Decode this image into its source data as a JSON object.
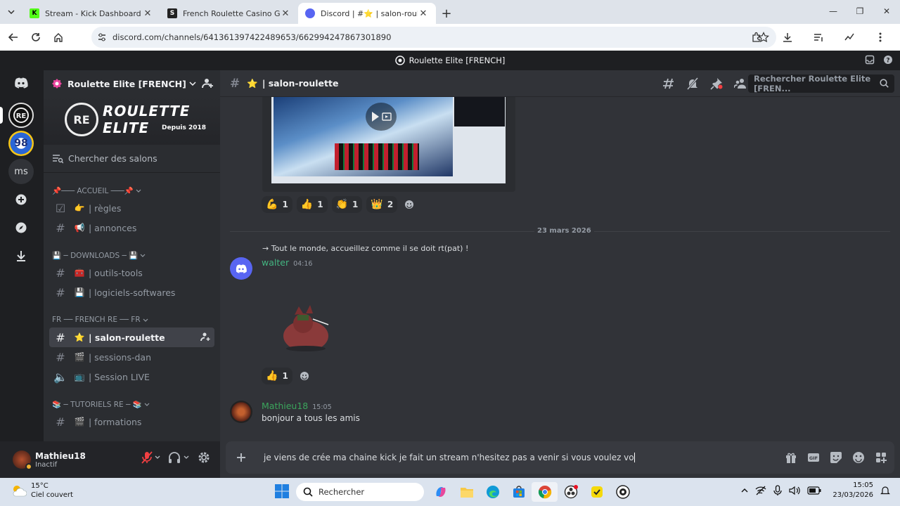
{
  "browser": {
    "tabs": [
      {
        "title": "Stream - Kick Dashboard",
        "favicon_color": "#53fc18",
        "favicon_letter": "K"
      },
      {
        "title": "French Roulette Casino Game p",
        "favicon_color": "#222222",
        "favicon_letter": "S"
      },
      {
        "title": "Discord | #⭐ | salon-roulette",
        "favicon_color": "#5865f2",
        "favicon_letter": ""
      }
    ],
    "url": "discord.com/channels/641361397422489653/662994247867301890"
  },
  "discord": {
    "window_title": "Roulette Elite [FRENCH]",
    "guilds": [
      {
        "label": "",
        "icon": "discord-home-icon"
      },
      {
        "label": "",
        "icon": "roulette-elite-server-icon"
      },
      {
        "label": "98",
        "icon": "server-98-icon"
      },
      {
        "label": "ms",
        "icon": "server-ms-icon"
      },
      {
        "label": "",
        "icon": "add-server-icon"
      },
      {
        "label": "",
        "icon": "explore-icon"
      },
      {
        "label": "",
        "icon": "download-icon"
      }
    ],
    "server": {
      "name": "Roulette Elite [FRENCH]",
      "banner_line1": "ROULETTE",
      "banner_line2": "ELITE",
      "banner_since": "Depuis 2018",
      "banner_logo": "RE",
      "browse_channels": "Chercher des salons",
      "categories": [
        {
          "label": "📌─── ACCUEIL ───📌",
          "channels": [
            {
              "emoji": "👉",
              "name": "| règles",
              "type": "rules"
            },
            {
              "emoji": "📢",
              "name": "| annonces",
              "type": "text"
            }
          ]
        },
        {
          "label": "💾 ─ DOWNLOADS ─ 💾",
          "channels": [
            {
              "emoji": "🧰",
              "name": "| outils-tools",
              "type": "text"
            },
            {
              "emoji": "💾",
              "name": "| logiciels-softwares",
              "type": "text"
            }
          ]
        },
        {
          "label": "FR ── FRENCH RE ── FR",
          "channels": [
            {
              "emoji": "⭐",
              "name": "| salon-roulette",
              "type": "text",
              "selected": true
            },
            {
              "emoji": "🎬",
              "name": "| sessions-dan",
              "type": "text"
            },
            {
              "emoji": "📺",
              "name": "| Session LIVE",
              "type": "voice"
            }
          ]
        },
        {
          "label": "📚 ─ TUTORIELS RE ─ 📚",
          "channels": [
            {
              "emoji": "🎬",
              "name": "| formations",
              "type": "text"
            }
          ]
        }
      ]
    },
    "user": {
      "name": "Mathieu18",
      "status": "Inactif"
    },
    "channel": {
      "emoji": "⭐",
      "name": "| salon-roulette",
      "search_placeholder": "Rechercher Roulette Elite [FREN..."
    },
    "messages": {
      "reactions_1": [
        {
          "emoji": "💪",
          "count": "1"
        },
        {
          "emoji": "👍",
          "count": "1"
        },
        {
          "emoji": "👏",
          "count": "1"
        },
        {
          "emoji": "👑",
          "count": "2"
        }
      ],
      "date_divider": "23 mars 2026",
      "reply_preview": "→ Tout le monde, accueillez comme il se doit rt(pat) !",
      "walter": {
        "author": "walter",
        "time": "04:16",
        "author_color": "#43b581"
      },
      "reactions_2": [
        {
          "emoji": "👍",
          "count": "1"
        }
      ],
      "mathieu": {
        "author": "Mathieu18",
        "time": "15:05",
        "text": "bonjour a tous les amis",
        "author_color": "#3ba55c"
      }
    },
    "composer_text": "je viens de crée ma chaine kick je fait un stream n'hesitez pas a venir si vous voulez vo"
  },
  "taskbar": {
    "weather_temp": "15°C",
    "weather_desc": "Ciel couvert",
    "search": "Rechercher",
    "time": "15:05",
    "date": "23/03/2026"
  }
}
